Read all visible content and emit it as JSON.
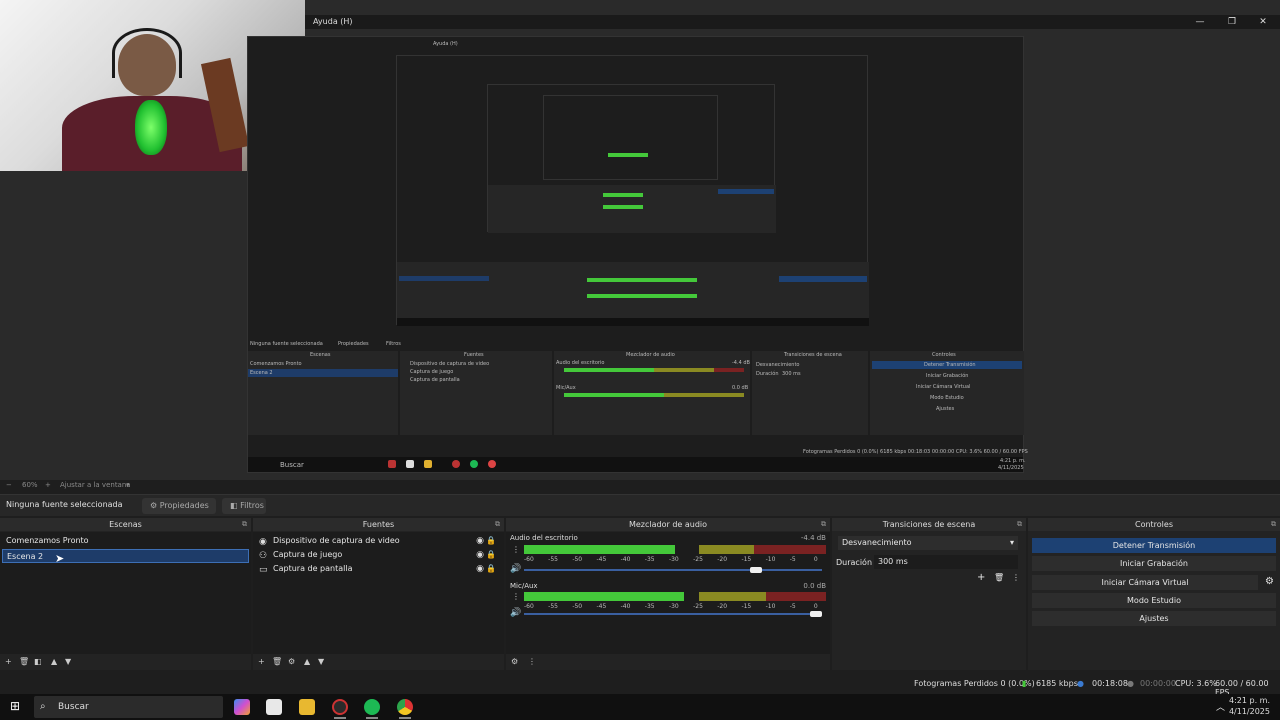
{
  "window": {
    "title": "Ayuda (H)",
    "nested_title": "Ayuda (H)",
    "controls": [
      "—",
      "❐",
      "✕"
    ]
  },
  "preview": {
    "zoom_label": "60%",
    "fit_label": "Ajustar a la ventana",
    "nested": {
      "no_source": "Ninguna fuente seleccionada",
      "properties": "Propiedades",
      "filters": "Filtros",
      "scenes_header": "Escenas",
      "sources_header": "Fuentes",
      "mixer_header": "Mezclador de audio",
      "transitions_header": "Transiciones de escena",
      "controls_header": "Controles",
      "scenes": [
        "Comenzamos Pronto",
        "Escena 2"
      ],
      "sources": [
        "Dispositivo de captura de video",
        "Captura de juego",
        "Captura de pantalla"
      ],
      "track1": "Audio del escritorio",
      "track1_db": "-4.4 dB",
      "track2": "Mic/Aux",
      "track2_db": "0.0 dB",
      "transition": "Desvanecimiento",
      "duration_label": "Duración",
      "duration_value": "300 ms",
      "controls": [
        "Detener Transmisión",
        "Iniciar Grabación",
        "Iniciar Cámara Virtual",
        "Modo Estudio",
        "Ajustes"
      ],
      "status": "Fotogramas Perdidos 0 (0.0%)  6185 kbps  00:18:03  00:00:00  CPU: 3.6%  60.00 / 60.00 FPS",
      "search": "Buscar",
      "time": "4:21 p. m.",
      "date": "4/11/2025"
    }
  },
  "source_bar": {
    "no_source": "Ninguna fuente seleccionada",
    "properties_label": "Propiedades",
    "filters_label": "Filtros"
  },
  "scenes": {
    "header": "Escenas",
    "items": [
      "Comenzamos Pronto",
      "Escena 2"
    ],
    "selected_index": 1
  },
  "sources": {
    "header": "Fuentes",
    "items": [
      {
        "label": "Dispositivo de captura de video",
        "icon": "camera-icon"
      },
      {
        "label": "Captura de juego",
        "icon": "gamepad-icon"
      },
      {
        "label": "Captura de pantalla",
        "icon": "monitor-icon"
      }
    ]
  },
  "mixer": {
    "header": "Mezclador de audio",
    "tracks": [
      {
        "name": "Audio del escritorio",
        "db": "-4.4 dB",
        "level": 0.5,
        "volume": 0.8
      },
      {
        "name": "Mic/Aux",
        "db": "0.0 dB",
        "level": 0.53,
        "volume": 1.0
      }
    ],
    "ticks": [
      "-60",
      "-55",
      "-50",
      "-45",
      "-40",
      "-35",
      "-30",
      "-25",
      "-20",
      "-15",
      "-10",
      "-5",
      "0"
    ]
  },
  "transitions": {
    "header": "Transiciones de escena",
    "selected": "Desvanecimiento",
    "duration_label": "Duración",
    "duration_value": "300 ms"
  },
  "controls": {
    "header": "Controles",
    "buttons": [
      "Detener Transmisión",
      "Iniciar Grabación",
      "Iniciar Cámara Virtual",
      "Modo Estudio",
      "Ajustes"
    ]
  },
  "status": {
    "dropped_frames": "Fotogramas Perdidos 0 (0.0%)",
    "bitrate": "6185 kbps",
    "stream_time": "00:18:08",
    "record_time": "00:00:00",
    "cpu": "CPU: 3.6%",
    "fps": "60.00 / 60.00 FPS"
  },
  "taskbar": {
    "search_placeholder": "Buscar",
    "time": "4:21 p. m.",
    "date": "4/11/2025"
  },
  "colors": {
    "accent_blue": "#1d4173",
    "meter_green": "#44c83a",
    "selected_scene": "#1e3c69"
  }
}
